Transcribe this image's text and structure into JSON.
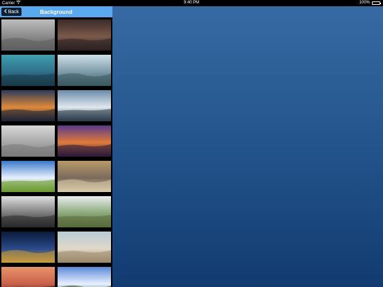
{
  "statusbar": {
    "carrier": "Carrier",
    "time": "9:40 PM",
    "battery": "100%",
    "wifi_icon": "wifi-icon",
    "battery_icon": "battery-icon"
  },
  "navbar": {
    "back_label": "Back",
    "back_icon": "chevron-left-icon",
    "title": "Background"
  },
  "thumbnails": [
    {
      "name": "foggy-grey-horizon",
      "colors": [
        "#bdbdbd",
        "#8a8a8a",
        "#5e5e5e"
      ]
    },
    {
      "name": "dusk-hills-road",
      "colors": [
        "#3a2a28",
        "#7a5a4a",
        "#2a2022"
      ]
    },
    {
      "name": "mountains-teal-sky",
      "colors": [
        "#3fa0b0",
        "#2f6f8a",
        "#1a3a4a"
      ]
    },
    {
      "name": "coastal-peninsula",
      "colors": [
        "#cfe0e8",
        "#7d9aa8",
        "#3a5a60"
      ]
    },
    {
      "name": "ocean-sunset",
      "colors": [
        "#2b3a5a",
        "#e08a3a",
        "#1a2235"
      ]
    },
    {
      "name": "snowy-rooftops",
      "colors": [
        "#6a8aa8",
        "#dfe8ee",
        "#2a3a4a"
      ]
    },
    {
      "name": "misty-lake-island",
      "colors": [
        "#d8d8d8",
        "#a8a8a8",
        "#7a7a7a"
      ]
    },
    {
      "name": "purple-beach-sunset",
      "colors": [
        "#5a3a8a",
        "#e07a3a",
        "#2a1a3a"
      ]
    },
    {
      "name": "green-meadow-clouds",
      "colors": [
        "#3a78c8",
        "#e8f0ff",
        "#6a9a2a"
      ]
    },
    {
      "name": "aerial-city",
      "colors": [
        "#b89a6a",
        "#7a6a5a",
        "#d8c8a8"
      ]
    },
    {
      "name": "bw-rocky-shore",
      "colors": [
        "#e0e0e0",
        "#7a7a7a",
        "#2a2a2a"
      ]
    },
    {
      "name": "green-coastal-cliffs",
      "colors": [
        "#e8eef0",
        "#8aa878",
        "#5a6a3a"
      ]
    },
    {
      "name": "night-harbor",
      "colors": [
        "#0a1a3a",
        "#2a4a8a",
        "#c89a3a"
      ]
    },
    {
      "name": "sand-dunes-grass",
      "colors": [
        "#b8ccd8",
        "#e0d8c8",
        "#9a8a6a"
      ]
    },
    {
      "name": "orange-sky-silhouette",
      "colors": [
        "#e8946a",
        "#c8604a",
        "#2a1a1a"
      ]
    },
    {
      "name": "lake-treeline",
      "colors": [
        "#5a8ad8",
        "#e8f0ff",
        "#2a4a2a"
      ]
    }
  ]
}
